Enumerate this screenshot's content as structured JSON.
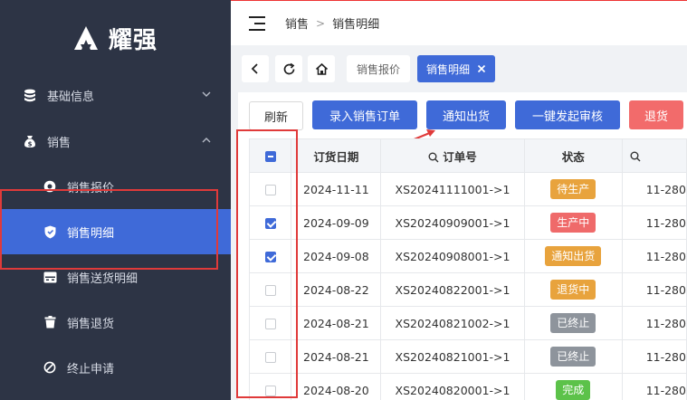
{
  "brand": {
    "name": "耀强"
  },
  "sidebar": {
    "groups": [
      {
        "label": "基础信息",
        "icon": "database-icon",
        "expanded": false
      },
      {
        "label": "销售",
        "icon": "money-bag-icon",
        "expanded": true
      }
    ],
    "items": [
      {
        "label": "销售报价",
        "icon": "quote-icon"
      },
      {
        "label": "销售明细",
        "icon": "shield-icon",
        "active": true
      },
      {
        "label": "销售送货明细",
        "icon": "delivery-icon"
      },
      {
        "label": "销售退货",
        "icon": "trash-icon"
      },
      {
        "label": "终止申请",
        "icon": "stop-icon"
      }
    ]
  },
  "breadcrumb": [
    "销售",
    "销售明细"
  ],
  "tabs": [
    {
      "label": "销售报价",
      "active": false
    },
    {
      "label": "销售明细",
      "active": true
    }
  ],
  "toolbar": {
    "refresh": "刷新",
    "enter_order": "录入销售订单",
    "notify_ship": "通知出货",
    "submit_review": "一键发起审核",
    "return": "退货"
  },
  "table": {
    "columns": [
      "订货日期",
      "订单号",
      "状态",
      "11-280"
    ],
    "rows": [
      {
        "date": "2024-11-11",
        "order": "XS20241111001->1",
        "status": "待生产",
        "status_color": "orange",
        "extra": "11-280",
        "checked": false
      },
      {
        "date": "2024-09-09",
        "order": "XS20240909001->1",
        "status": "生产中",
        "status_color": "red",
        "extra": "11-280",
        "checked": true
      },
      {
        "date": "2024-09-08",
        "order": "XS20240908001->1",
        "status": "通知出货",
        "status_color": "orange",
        "extra": "11-280",
        "checked": true
      },
      {
        "date": "2024-08-22",
        "order": "XS20240822001->1",
        "status": "退货中",
        "status_color": "orange",
        "extra": "11-280",
        "checked": false
      },
      {
        "date": "2024-08-21",
        "order": "XS20240821002->1",
        "status": "已终止",
        "status_color": "gray",
        "extra": "11-280",
        "checked": false
      },
      {
        "date": "2024-08-21",
        "order": "XS20240821001->1",
        "status": "已终止",
        "status_color": "gray",
        "extra": "11-280",
        "checked": false
      },
      {
        "date": "2024-08-20",
        "order": "XS20240820001->1",
        "status": "完成",
        "status_color": "green",
        "extra": "11-280",
        "checked": false
      }
    ]
  },
  "colors": {
    "sidebar_bg": "#2d3445",
    "accent": "#3f6ad8",
    "danger": "#f26b6b",
    "annotation": "#e03a3a"
  }
}
